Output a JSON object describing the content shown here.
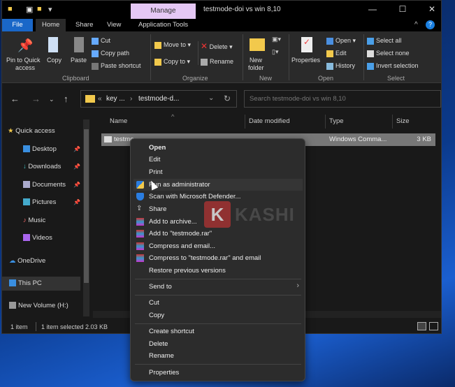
{
  "window": {
    "title": "testmode-doi vs win 8,10",
    "context_tab": "Manage",
    "minimize": "—",
    "maximize": "☐",
    "close": "✕"
  },
  "tabs": [
    "File",
    "Home",
    "Share",
    "View",
    "Application Tools"
  ],
  "ribbon": {
    "clipboard": {
      "pin": "Pin to Quick",
      "pin2": "access",
      "copy": "Copy",
      "paste": "Paste",
      "cut": "Cut",
      "copy_path": "Copy path",
      "paste_shortcut": "Paste shortcut",
      "label": "Clipboard"
    },
    "organize": {
      "move_to": "Move to ▾",
      "copy_to": "Copy to ▾",
      "delete": "Delete ▾",
      "rename": "Rename",
      "label": "Organize"
    },
    "new": {
      "new_folder": "New",
      "new_folder2": "folder",
      "label": "New"
    },
    "open": {
      "properties": "Properties",
      "open": "Open ▾",
      "edit": "Edit",
      "history": "History",
      "label": "Open"
    },
    "select": {
      "select_all": "Select all",
      "select_none": "Select none",
      "invert": "Invert selection",
      "label": "Select"
    }
  },
  "address": {
    "path_prefix": "«",
    "crumb1": "key ...",
    "crumb2": "testmode-d...",
    "search_placeholder": "Search testmode-doi vs win 8,10"
  },
  "sidebar": [
    {
      "label": "Quick access",
      "pinned": false
    },
    {
      "label": "Desktop",
      "pinned": true
    },
    {
      "label": "Downloads",
      "pinned": true
    },
    {
      "label": "Documents",
      "pinned": true
    },
    {
      "label": "Pictures",
      "pinned": true
    },
    {
      "label": "Music",
      "pinned": false
    },
    {
      "label": "Videos",
      "pinned": false
    },
    {
      "label": "OneDrive",
      "pinned": false
    },
    {
      "label": "This PC",
      "pinned": false
    },
    {
      "label": "New Volume (H:)",
      "pinned": false
    }
  ],
  "columns": [
    "Name",
    "Date modified",
    "Type",
    "Size"
  ],
  "file": {
    "name": "testmo",
    "type": "Windows Comma...",
    "size": "3 KB"
  },
  "status": {
    "count": "1 item",
    "selected": "1 item selected  2.03 KB"
  },
  "context_menu": {
    "open": "Open",
    "edit": "Edit",
    "print": "Print",
    "run_admin": "Run as administrator",
    "scan": "Scan with Microsoft Defender...",
    "share": "Share",
    "add_archive": "Add to archive...",
    "add_rar": "Add to \"testmode.rar\"",
    "compress_email": "Compress and email...",
    "compress_rar_email": "Compress to \"testmode.rar\" and email",
    "restore": "Restore previous versions",
    "send_to": "Send to",
    "cut": "Cut",
    "copy": "Copy",
    "create_shortcut": "Create shortcut",
    "delete": "Delete",
    "rename": "Rename",
    "properties": "Properties"
  },
  "watermark": {
    "letter": "K",
    "text": "KASHI"
  },
  "colors": {
    "accent": "#1a67c8",
    "manage": "#e5c8f5",
    "selection": "#777777"
  }
}
